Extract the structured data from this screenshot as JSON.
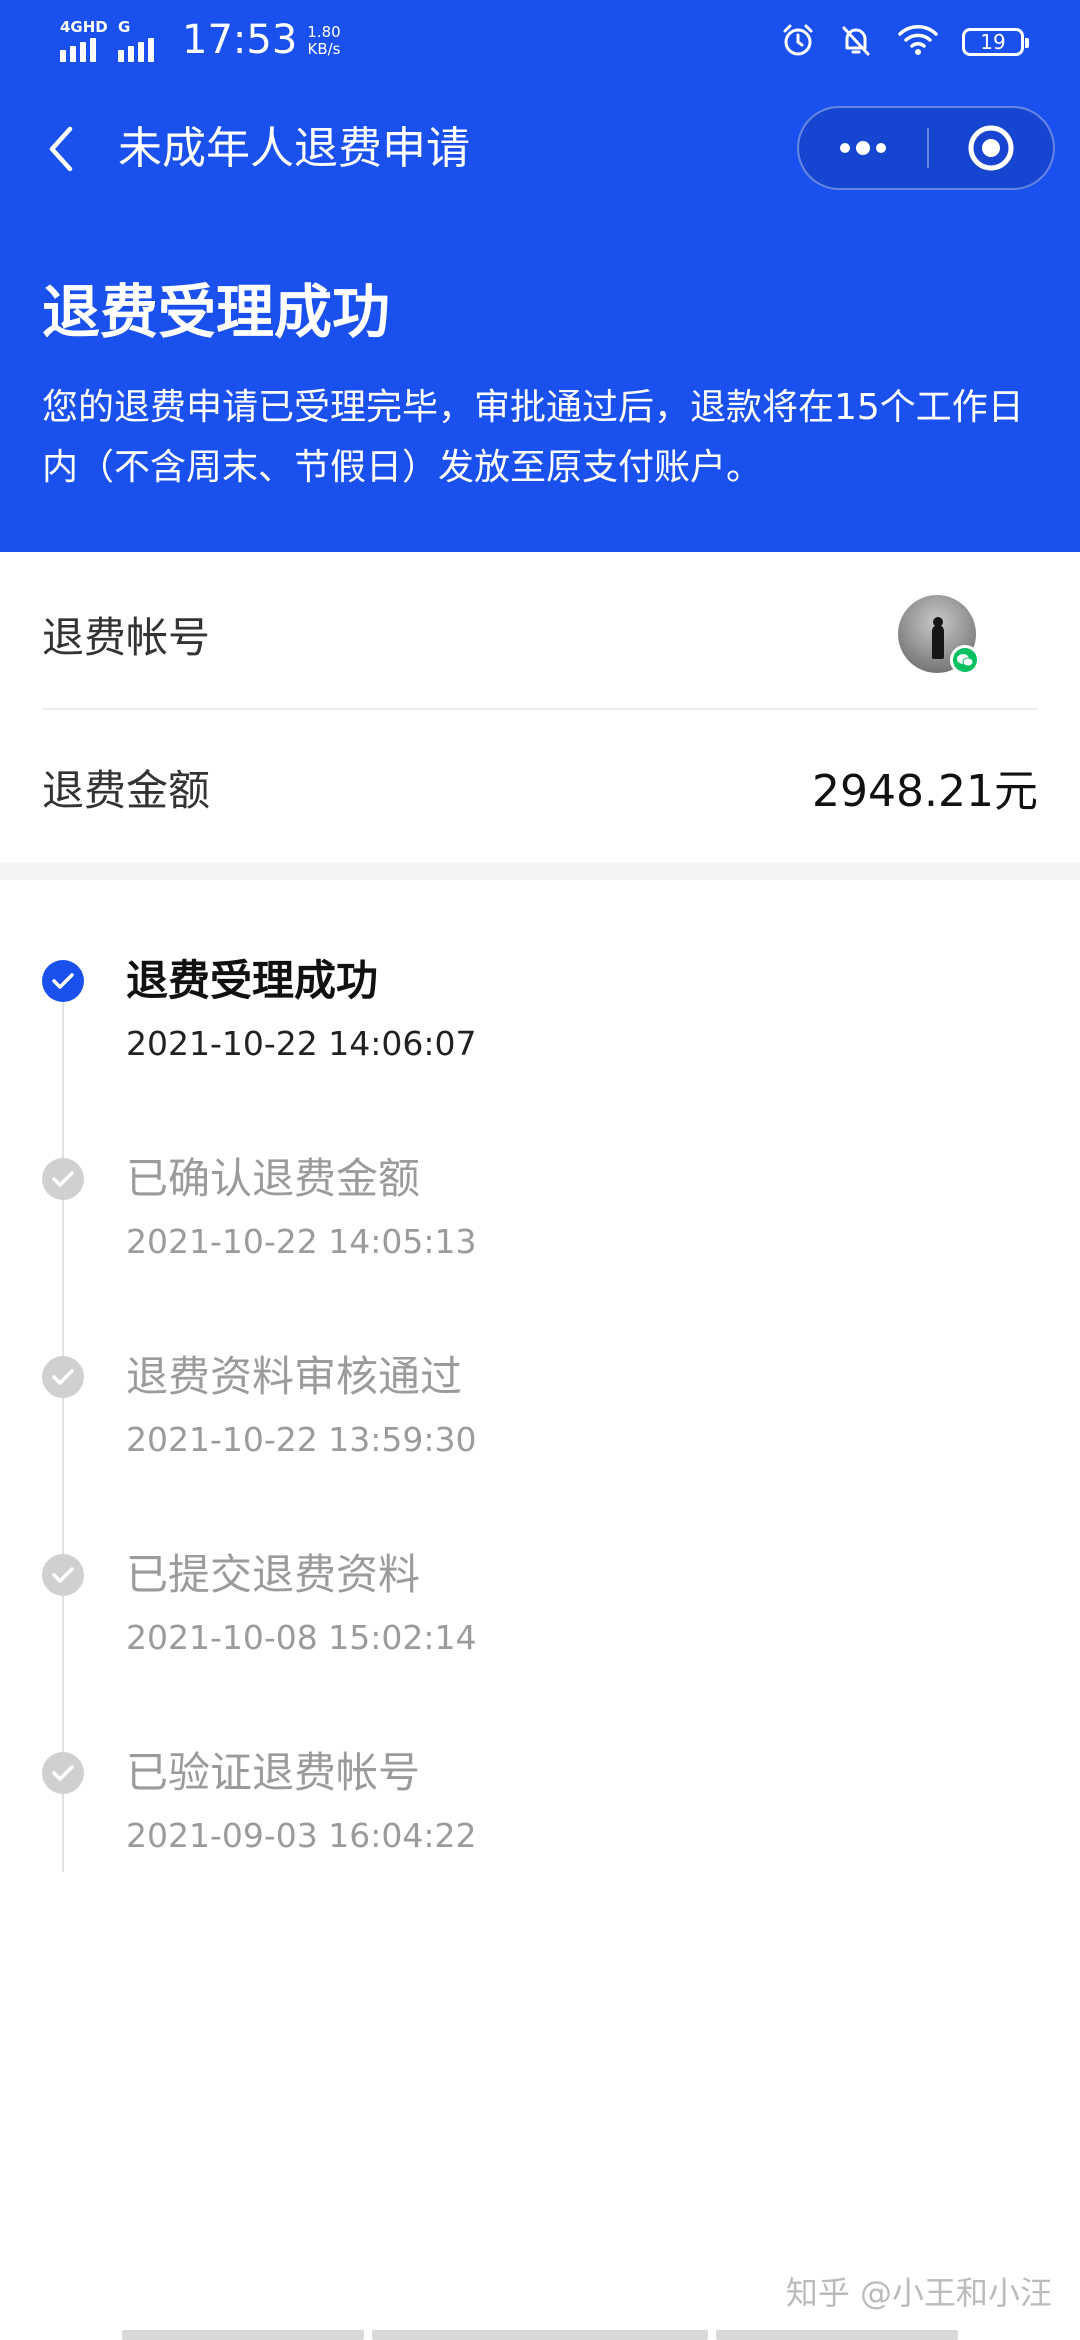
{
  "status_bar": {
    "net1": "4GHD",
    "net2": "G",
    "time": "17:53",
    "speed_value": "1.80",
    "speed_unit": "KB/s",
    "battery": "19",
    "icons": [
      "alarm-icon",
      "bell-off-icon",
      "wifi-icon",
      "battery-icon"
    ]
  },
  "nav": {
    "title": "未成年人退费申请",
    "back_icon": "chevron-left-icon",
    "more_icon": "more-dots-icon",
    "close_icon": "target-close-icon"
  },
  "header": {
    "heading": "退费受理成功",
    "description": "您的退费申请已受理完毕，审批通过后，退款将在15个工作日内（不含周末、节假日）发放至原支付账户。"
  },
  "info": {
    "account_label": "退费帐号",
    "amount_label": "退费金额",
    "amount_value": "2948.21元"
  },
  "timeline": [
    {
      "title": "退费受理成功",
      "time": "2021-10-22 14:06:07",
      "active": true
    },
    {
      "title": "已确认退费金额",
      "time": "2021-10-22 14:05:13",
      "active": false
    },
    {
      "title": "退费资料审核通过",
      "time": "2021-10-22 13:59:30",
      "active": false
    },
    {
      "title": "已提交退费资料",
      "time": "2021-10-08 15:02:14",
      "active": false
    },
    {
      "title": "已验证退费帐号",
      "time": "2021-09-03 16:04:22",
      "active": false
    }
  ],
  "watermark": "知乎 @小王和小汪",
  "colors": {
    "primary": "#1a50ee",
    "inactive": "#d0d0d0",
    "wechat": "#07c160"
  }
}
